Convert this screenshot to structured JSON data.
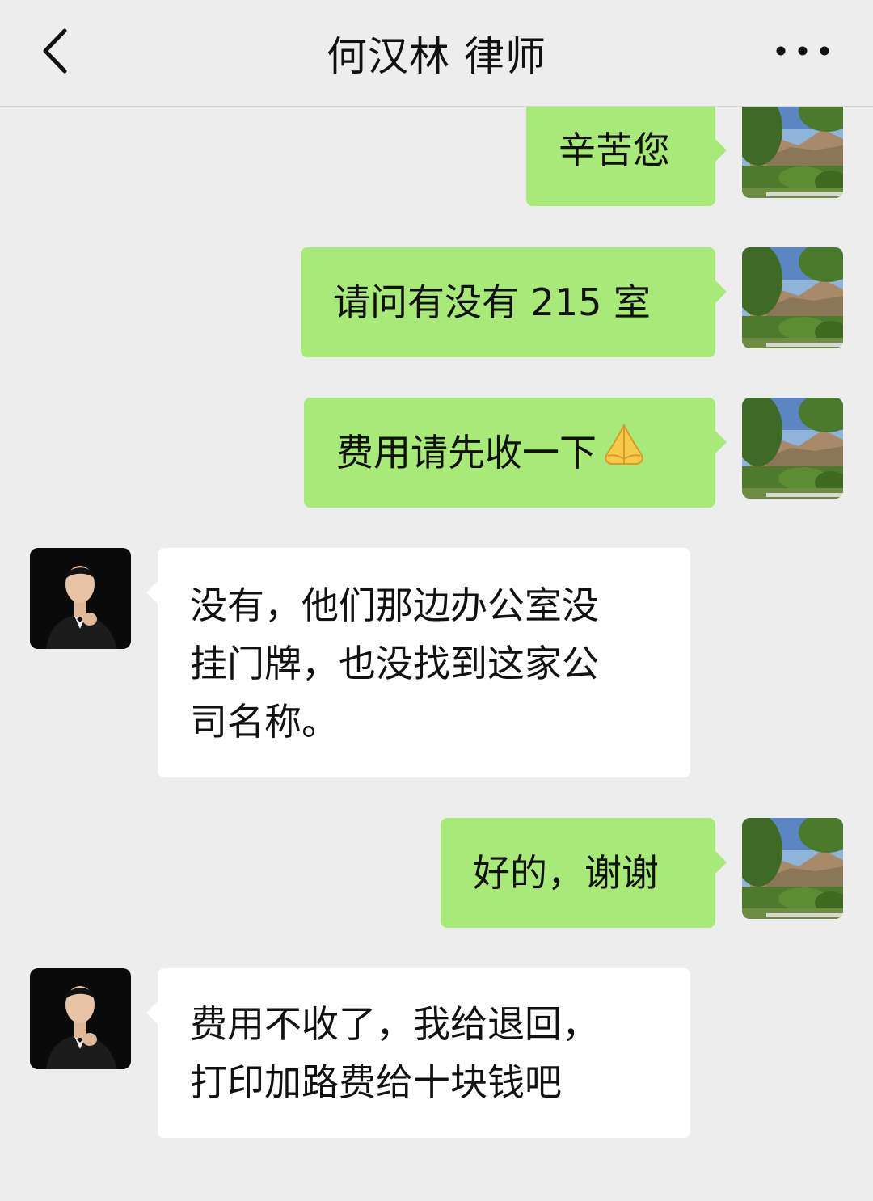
{
  "header": {
    "title": "何汉林 律师",
    "back_icon": "chevron-left-icon",
    "more_icon": "more-dots-icon"
  },
  "colors": {
    "background": "#ededed",
    "my_bubble": "#a9e97a",
    "their_bubble": "#ffffff"
  },
  "messages": [
    {
      "sender": "me",
      "text": "辛苦您"
    },
    {
      "sender": "me",
      "text": "请问有没有 215 室"
    },
    {
      "sender": "me",
      "text": "费用请先收一下",
      "emoji": "folded-hands-emoji"
    },
    {
      "sender": "them",
      "lines": [
        "没有，他们那边办公室没",
        "挂门牌，也没找到这家公",
        "司名称。"
      ]
    },
    {
      "sender": "me",
      "text": "好的，谢谢"
    },
    {
      "sender": "them",
      "lines": [
        "费用不收了，我给退回，",
        "打印加路费给十块钱吧"
      ]
    }
  ]
}
